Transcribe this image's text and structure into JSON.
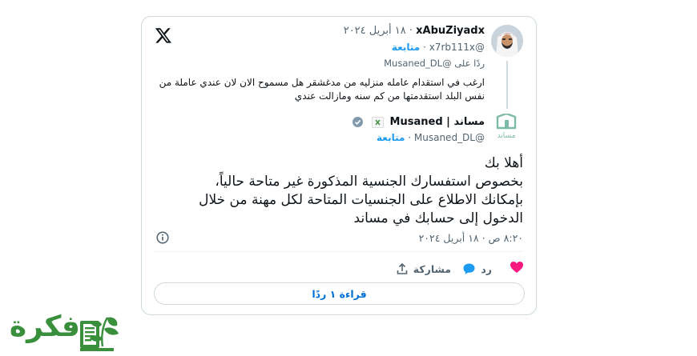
{
  "tweet": {
    "author_name": "xAbuZiyadx",
    "date": "· ١٨ أبريل ٢٠٢٤",
    "handle": "@x7rb111x",
    "follow_label": "متابعة",
    "reply_to": "ردًا على @Musaned_DL",
    "text": "ارغب في استقدام عامله منزليه من مدغشقر هل مسموح الان لان عندي عاملة من نفس البلد استقدمتها من كم سنه ومازالت عندي",
    "icon": "x-logo"
  },
  "reply": {
    "author_name": "مساند | Musaned",
    "avatar_caption": "مساند",
    "handle": "@Musaned_DL",
    "follow_label": "متابعة",
    "lines": [
      "أهلا بك",
      "بخصوص استفسارك الجنسية المذكورة غير متاحة حالياً،",
      "بإمكانك الاطلاع على الجنسيات المتاحة لكل مهنة من خلال",
      "الدخول إلى حسابك في مساند"
    ],
    "timestamp": "٨:٢٠ ص · ١٨ أبريل ٢٠٢٤",
    "verified_color": "#829aab"
  },
  "actions": {
    "share_label": "مشاركة",
    "reply_label": "رد",
    "like_color": "#f91880",
    "reply_color": "#1d9bf0"
  },
  "replies_button": {
    "label": "قراءة ١ ردًا"
  },
  "watermark": {
    "text": "فكرة",
    "color": "#3a8f3c"
  }
}
